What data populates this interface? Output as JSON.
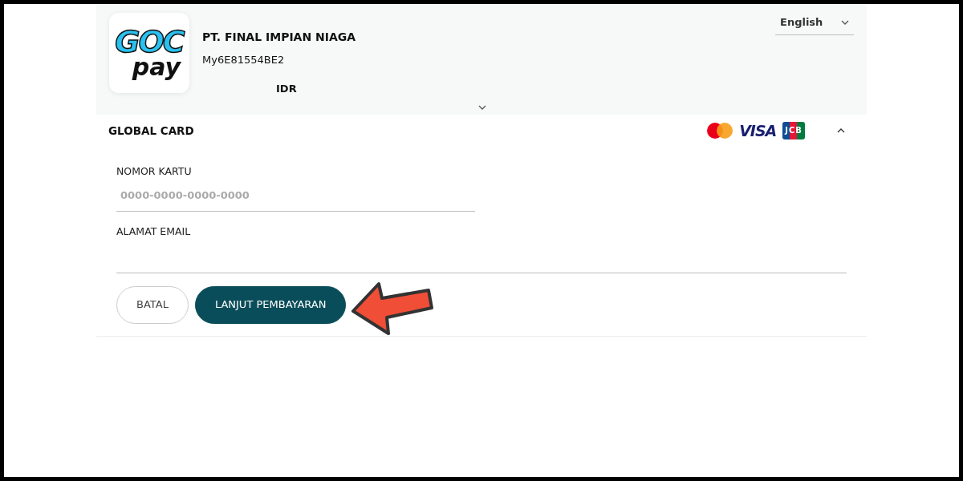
{
  "merchant": {
    "logo": {
      "top": "GOC",
      "bottom": "pay"
    },
    "name": "PT. FINAL IMPIAN NIAGA",
    "id": "My6E81554BE2",
    "currency": "IDR"
  },
  "language": {
    "value": "English"
  },
  "payment_section": {
    "title": "GLOBAL CARD",
    "expanded": true,
    "card_brands": [
      {
        "kind": "mastercard"
      },
      {
        "kind": "visa",
        "label": "VISA"
      },
      {
        "kind": "jcb",
        "label": "JCB"
      }
    ],
    "fields": [
      {
        "label": "NOMOR KARTU",
        "placeholder": "0000-0000-0000-0000",
        "wide": false
      },
      {
        "label": "ALAMAT EMAIL",
        "wide": true
      }
    ],
    "buttons": [
      {
        "kind": "outline",
        "label": "BATAL"
      },
      {
        "kind": "primary",
        "label": "LANJUT PEMBAYARAN"
      }
    ]
  }
}
